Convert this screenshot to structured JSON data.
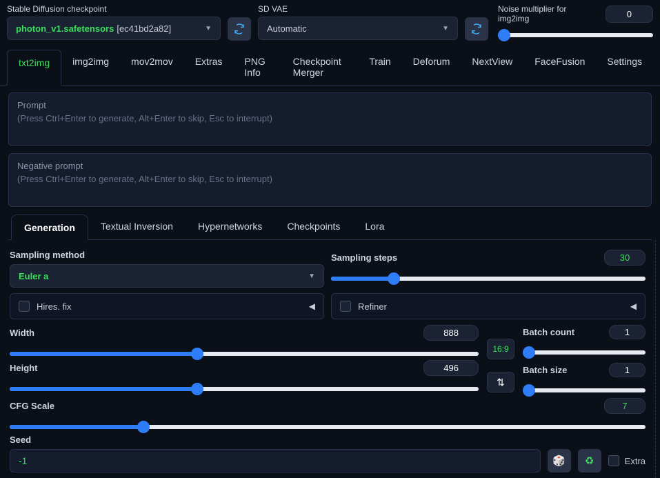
{
  "header": {
    "checkpoint_label": "Stable Diffusion checkpoint",
    "checkpoint_name": "photon_v1.safetensors",
    "checkpoint_hash": "[ec41bd2a82]",
    "vae_label": "SD VAE",
    "vae_value": "Automatic",
    "noise_label": "Noise multiplier for img2img",
    "noise_value": "0"
  },
  "tabs": [
    "txt2img",
    "img2img",
    "mov2mov",
    "Extras",
    "PNG Info",
    "Checkpoint Merger",
    "Train",
    "Deforum",
    "NextView",
    "FaceFusion",
    "Settings"
  ],
  "prompt": {
    "title": "Prompt",
    "hint": "(Press Ctrl+Enter to generate, Alt+Enter to skip, Esc to interrupt)"
  },
  "negprompt": {
    "title": "Negative prompt",
    "hint": "(Press Ctrl+Enter to generate, Alt+Enter to skip, Esc to interrupt)"
  },
  "subtabs": [
    "Generation",
    "Textual Inversion",
    "Hypernetworks",
    "Checkpoints",
    "Lora"
  ],
  "gen": {
    "sampling_method_label": "Sampling method",
    "sampling_method_value": "Euler a",
    "sampling_steps_label": "Sampling steps",
    "sampling_steps_value": "30",
    "hires_label": "Hires. fix",
    "refiner_label": "Refiner",
    "width_label": "Width",
    "width_value": "888",
    "height_label": "Height",
    "height_value": "496",
    "ratio": "16:9",
    "batch_count_label": "Batch count",
    "batch_count_value": "1",
    "batch_size_label": "Batch size",
    "batch_size_value": "1",
    "cfg_label": "CFG Scale",
    "cfg_value": "7",
    "seed_label": "Seed",
    "seed_value": "-1",
    "extra_label": "Extra"
  }
}
